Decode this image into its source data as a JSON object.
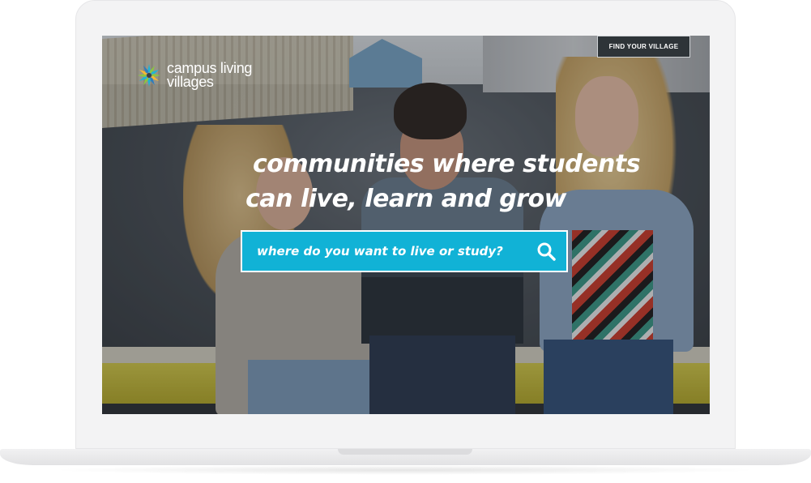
{
  "brand": {
    "name_line1": "campus living",
    "name_line2": "villages",
    "logo_colors": [
      "#1fb3d6",
      "#8cc63f",
      "#f7b733",
      "#2e7dbf"
    ]
  },
  "header": {
    "find_button_label": "FIND YOUR VILLAGE"
  },
  "hero": {
    "headline_line1": "communities where students",
    "headline_line2": "can live, learn and grow"
  },
  "search": {
    "placeholder": "where do you want to live or study?",
    "icon": "search-icon"
  },
  "colors": {
    "search_background": "#11b2d6",
    "button_background": "#2e3438"
  }
}
